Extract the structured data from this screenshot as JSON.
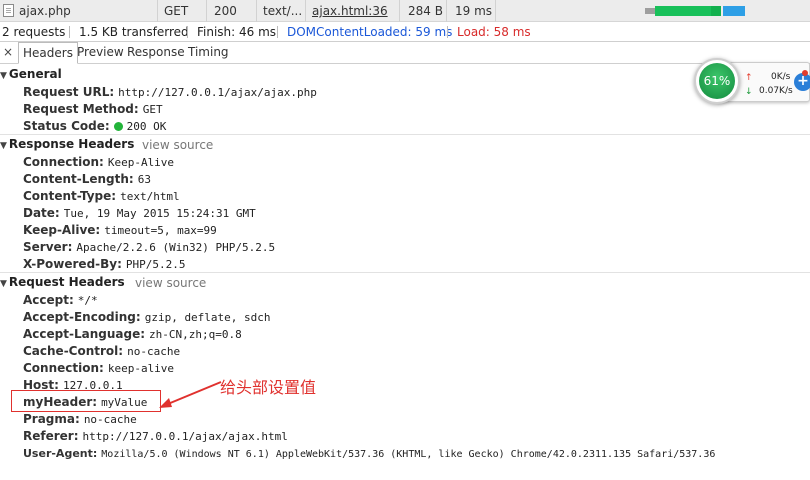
{
  "request": {
    "name": "ajax.php",
    "method": "GET",
    "status": "200",
    "type": "text/...",
    "initiator": "ajax.html:36",
    "size": "284 B",
    "time": "19 ms"
  },
  "summary": {
    "requests": "2 requests",
    "transferred": "1.5 KB transferred",
    "finish": "Finish: 46 ms",
    "dom_content_loaded": "DOMContentLoaded: 59 ms",
    "load": "Load: 58 ms"
  },
  "tabs": {
    "close": "×",
    "headers": "Headers",
    "preview": "Preview",
    "response": "Response",
    "timing": "Timing"
  },
  "general": {
    "title": "General",
    "rows": [
      {
        "key": "Request URL:",
        "value": "http://127.0.0.1/ajax/ajax.php"
      },
      {
        "key": "Request Method:",
        "value": "GET"
      },
      {
        "key": "Status Code:",
        "value": "200 OK"
      }
    ]
  },
  "response_headers": {
    "title": "Response Headers",
    "view_source": "view source",
    "rows": [
      {
        "key": "Connection:",
        "value": "Keep-Alive"
      },
      {
        "key": "Content-Length:",
        "value": "63"
      },
      {
        "key": "Content-Type:",
        "value": "text/html"
      },
      {
        "key": "Date:",
        "value": "Tue, 19 May 2015 15:24:31 GMT"
      },
      {
        "key": "Keep-Alive:",
        "value": "timeout=5, max=99"
      },
      {
        "key": "Server:",
        "value": "Apache/2.2.6 (Win32) PHP/5.2.5"
      },
      {
        "key": "X-Powered-By:",
        "value": "PHP/5.2.5"
      }
    ]
  },
  "request_headers": {
    "title": "Request Headers",
    "view_source": "view source",
    "rows": [
      {
        "key": "Accept:",
        "value": "*/*"
      },
      {
        "key": "Accept-Encoding:",
        "value": "gzip, deflate, sdch"
      },
      {
        "key": "Accept-Language:",
        "value": "zh-CN,zh;q=0.8"
      },
      {
        "key": "Cache-Control:",
        "value": "no-cache"
      },
      {
        "key": "Connection:",
        "value": "keep-alive"
      },
      {
        "key": "Host:",
        "value": "127.0.0.1"
      },
      {
        "key": "myHeader:",
        "value": "myValue"
      },
      {
        "key": "Pragma:",
        "value": "no-cache"
      },
      {
        "key": "Referer:",
        "value": "http://127.0.0.1/ajax/ajax.html"
      },
      {
        "key": "User-Agent:",
        "value": "Mozilla/5.0 (Windows NT 6.1) AppleWebKit/537.36 (KHTML, like Gecko) Chrome/42.0.2311.135 Safari/537.36"
      }
    ]
  },
  "annotation": "给头部设置值",
  "widget": {
    "percent": "61%",
    "upload": "0K/s",
    "download": "0.07K/s",
    "plus": "+"
  },
  "icons": {
    "up": "arrow-up-icon",
    "down": "arrow-down-icon",
    "status": "status-dot-icon"
  },
  "colors": {
    "highlight": "#e0312e",
    "link": "#1a57d8",
    "load": "#d82b2b",
    "status_ok": "#23b43a"
  }
}
